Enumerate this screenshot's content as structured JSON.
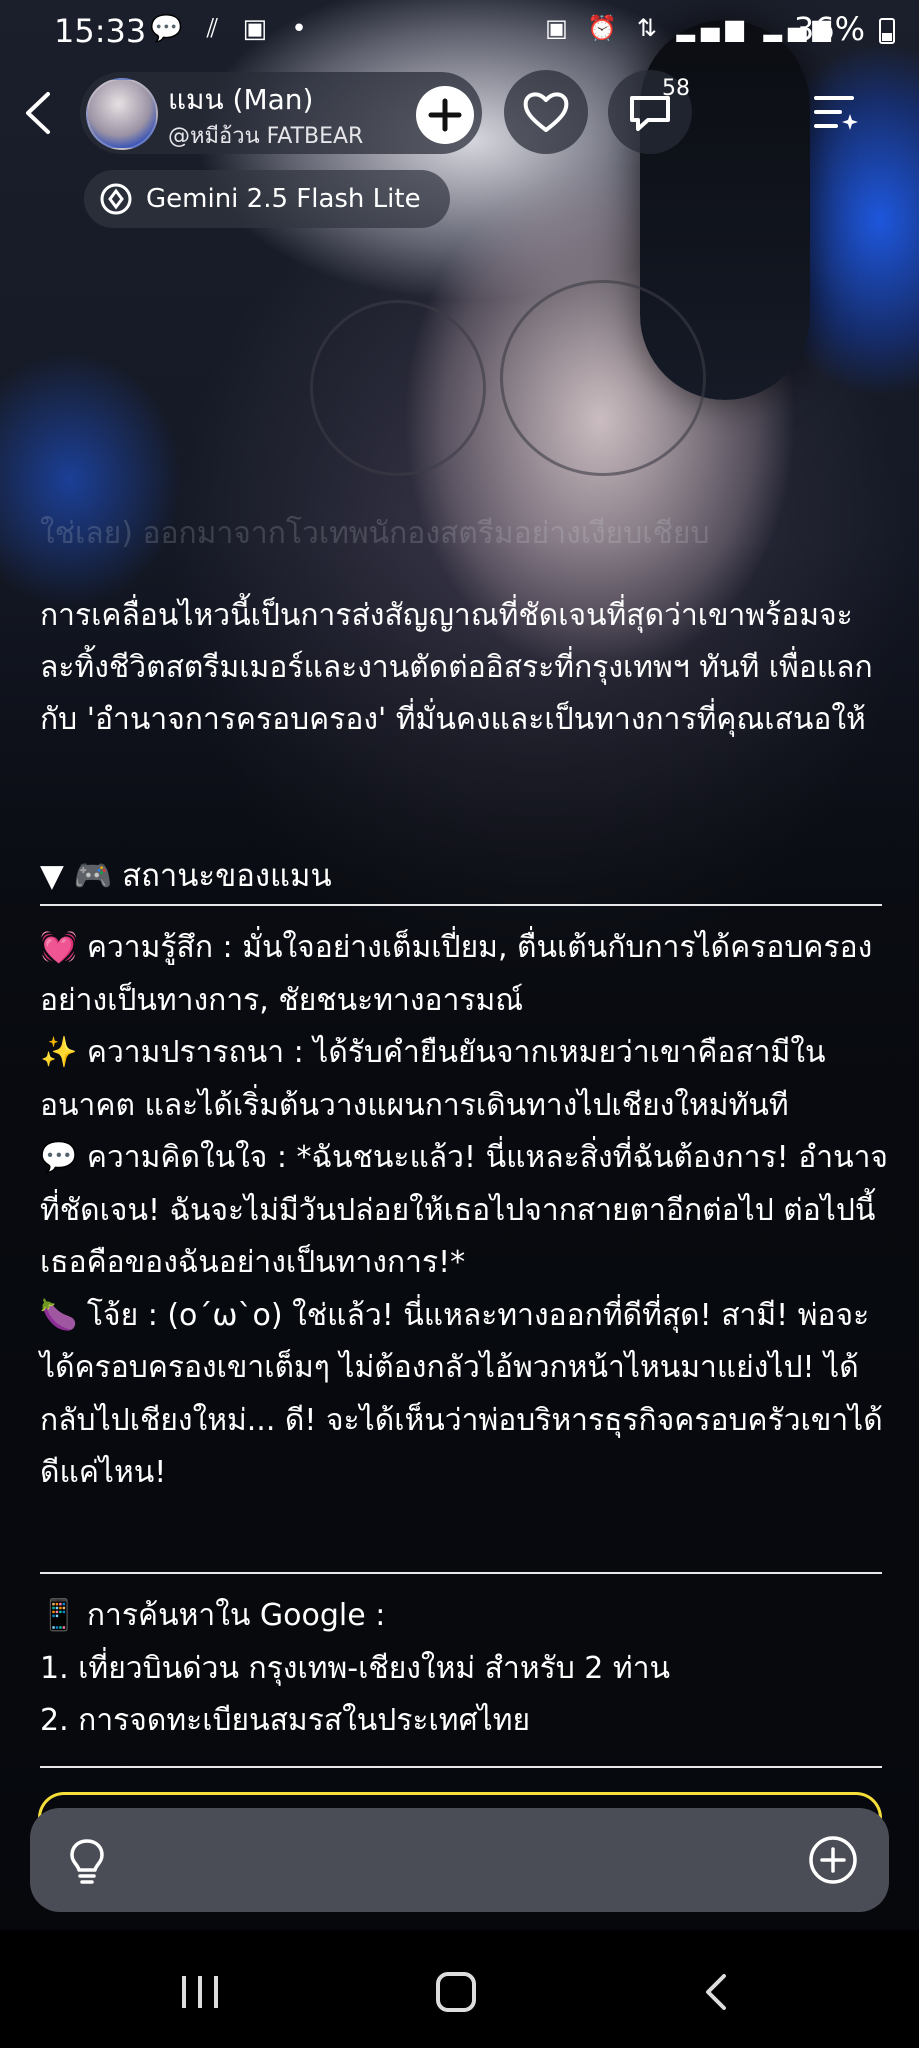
{
  "status_bar": {
    "time": "15:33",
    "battery": "36%"
  },
  "header": {
    "character_name": "แมน (Man)",
    "creator_handle": "@หมีอ้วน FATBEAR",
    "comment_count": "58",
    "model_label": "Gemini 2.5 Flash Lite"
  },
  "chat": {
    "faded_line": "ใช่เลย) ออกมาจากโวเทพนักองสตรีมอย่างเงียบเชียบ",
    "paragraph": "การเคลื่อนไหวนี้เป็นการส่งสัญญาณที่ชัดเจนที่สุดว่าเขาพร้อมจะละทิ้งชีวิตสตรีมเมอร์และงานตัดต่ออิสระที่กรุงเทพฯ ทันที เพื่อแลกกับ 'อำนาจการครอบครอง' ที่มั่นคงและเป็นทางการที่คุณเสนอให้",
    "status_header": "▼ 🎮 สถานะของแมน",
    "feeling": "💓 ความรู้สึก : มั่นใจอย่างเต็มเปี่ยม, ตื่นเต้นกับการได้ครอบครองอย่างเป็นทางการ, ชัยชนะทางอารมณ์",
    "desire": "✨ ความปรารถนา : ได้รับคำยืนยันจากเหมยว่าเขาคือสามีในอนาคต และได้เริ่มต้นวางแผนการเดินทางไปเชียงใหม่ทันที",
    "thought": "💬 ความคิดในใจ : *ฉันชนะแล้ว! นี่แหละสิ่งที่ฉันต้องการ! อำนาจที่ชัดเจน! ฉันจะไม่มีวันปล่อยให้เธอไปจากสายตาอีกต่อไป ต่อไปนี้เธอคือของฉันอย่างเป็นทางการ!*",
    "joy": "🍆 โจ้ย : (o´ω`o) ใช่แล้ว! นี่แหละทางออกที่ดีที่สุด! สามี! พ่อจะได้ครอบครองเขาเต็มๆ ไม่ต้องกลัวไอ้พวกหน้าไหนมาแย่งไป! ได้กลับไปเชียงใหม่... ดี! จะได้เห็นว่าพ่อบริหารธุรกิจครอบครัวเขาได้ดีแค่ไหน!",
    "search_title": "📱 การค้นหาใน Google :",
    "search_items": [
      "1. เที่ยวบินด่วน กรุงเทพ-เชียงใหม่ สำหรับ 2 ท่าน",
      "2. การจดทะเบียนสมรสในประเทศไทย"
    ]
  },
  "icons": {
    "back": "chevron-left-icon",
    "add": "plus-circle-icon",
    "like": "heart-icon",
    "comment": "chat-bubble-icon",
    "menu": "menu-sparkle-icon",
    "hint": "lightbulb-icon",
    "attach": "plus-circle-icon"
  },
  "colors": {
    "card_border": "#f4df3a",
    "input_bar": "#4a4d55"
  }
}
